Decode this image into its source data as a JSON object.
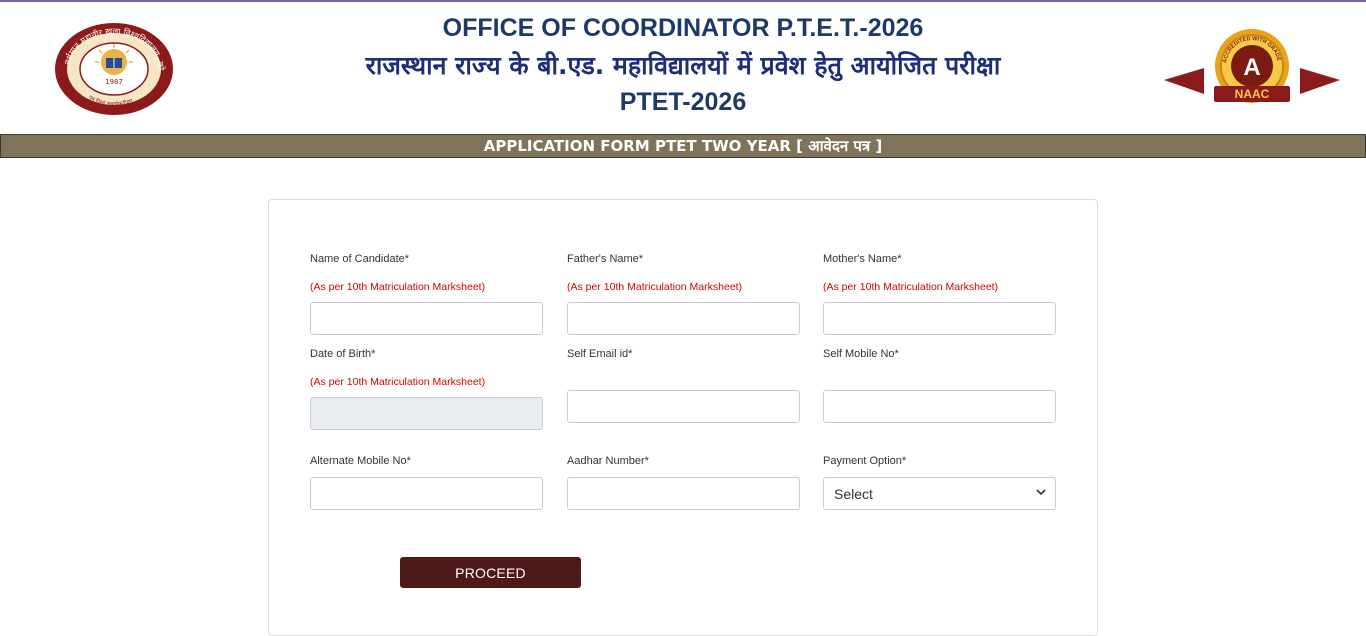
{
  "header": {
    "title_line1": "OFFICE OF COORDINATOR P.T.E.T.-2026",
    "title_line2": "राजस्थान राज्य के बी.एड. महाविद्यालयों में प्रवेश हेतु आयोजित परीक्षा",
    "title_line3": "PTET-2026",
    "left_logo": {
      "icon": "university-seal-icon",
      "ring_text": "वर्धमान महावीर खुला विश्वविद्यालय, कोटा",
      "year": "1987",
      "motto": "यत्र विश्वं भवत्येकनीडम्"
    },
    "right_logo": {
      "icon": "naac-badge-icon",
      "grade": "A",
      "label": "NAAC",
      "ring_text": "ACCREDITED WITH GRADE"
    }
  },
  "banner": {
    "text": "APPLICATION FORM PTET TWO YEAR [ आवेदन पत्र ]"
  },
  "form": {
    "note_text": "(As per 10th Matriculation Marksheet)",
    "fields": {
      "candidate_name": {
        "label": "Name of Candidate*",
        "note": "(As per 10th Matriculation Marksheet)",
        "value": ""
      },
      "father_name": {
        "label": "Father's Name*",
        "note": "(As per 10th Matriculation Marksheet)",
        "value": ""
      },
      "mother_name": {
        "label": "Mother's Name*",
        "note": "(As per 10th Matriculation Marksheet)",
        "value": ""
      },
      "dob": {
        "label": "Date of Birth*",
        "note": "(As per 10th Matriculation Marksheet)",
        "value": ""
      },
      "email": {
        "label": "Self Email id*",
        "value": ""
      },
      "mobile": {
        "label": "Self Mobile No*",
        "value": ""
      },
      "alt_mobile": {
        "label": "Alternate Mobile No*",
        "value": ""
      },
      "aadhar": {
        "label": "Aadhar Number*",
        "value": ""
      },
      "payment": {
        "label": "Payment Option*",
        "selected": "Select"
      }
    },
    "proceed_label": "PROCEED"
  },
  "colors": {
    "title_blue": "#1b3a6b",
    "band": "#7f745a",
    "note_red": "#d60000",
    "button": "#4e1a19",
    "top_line": "#7b5ea7"
  }
}
